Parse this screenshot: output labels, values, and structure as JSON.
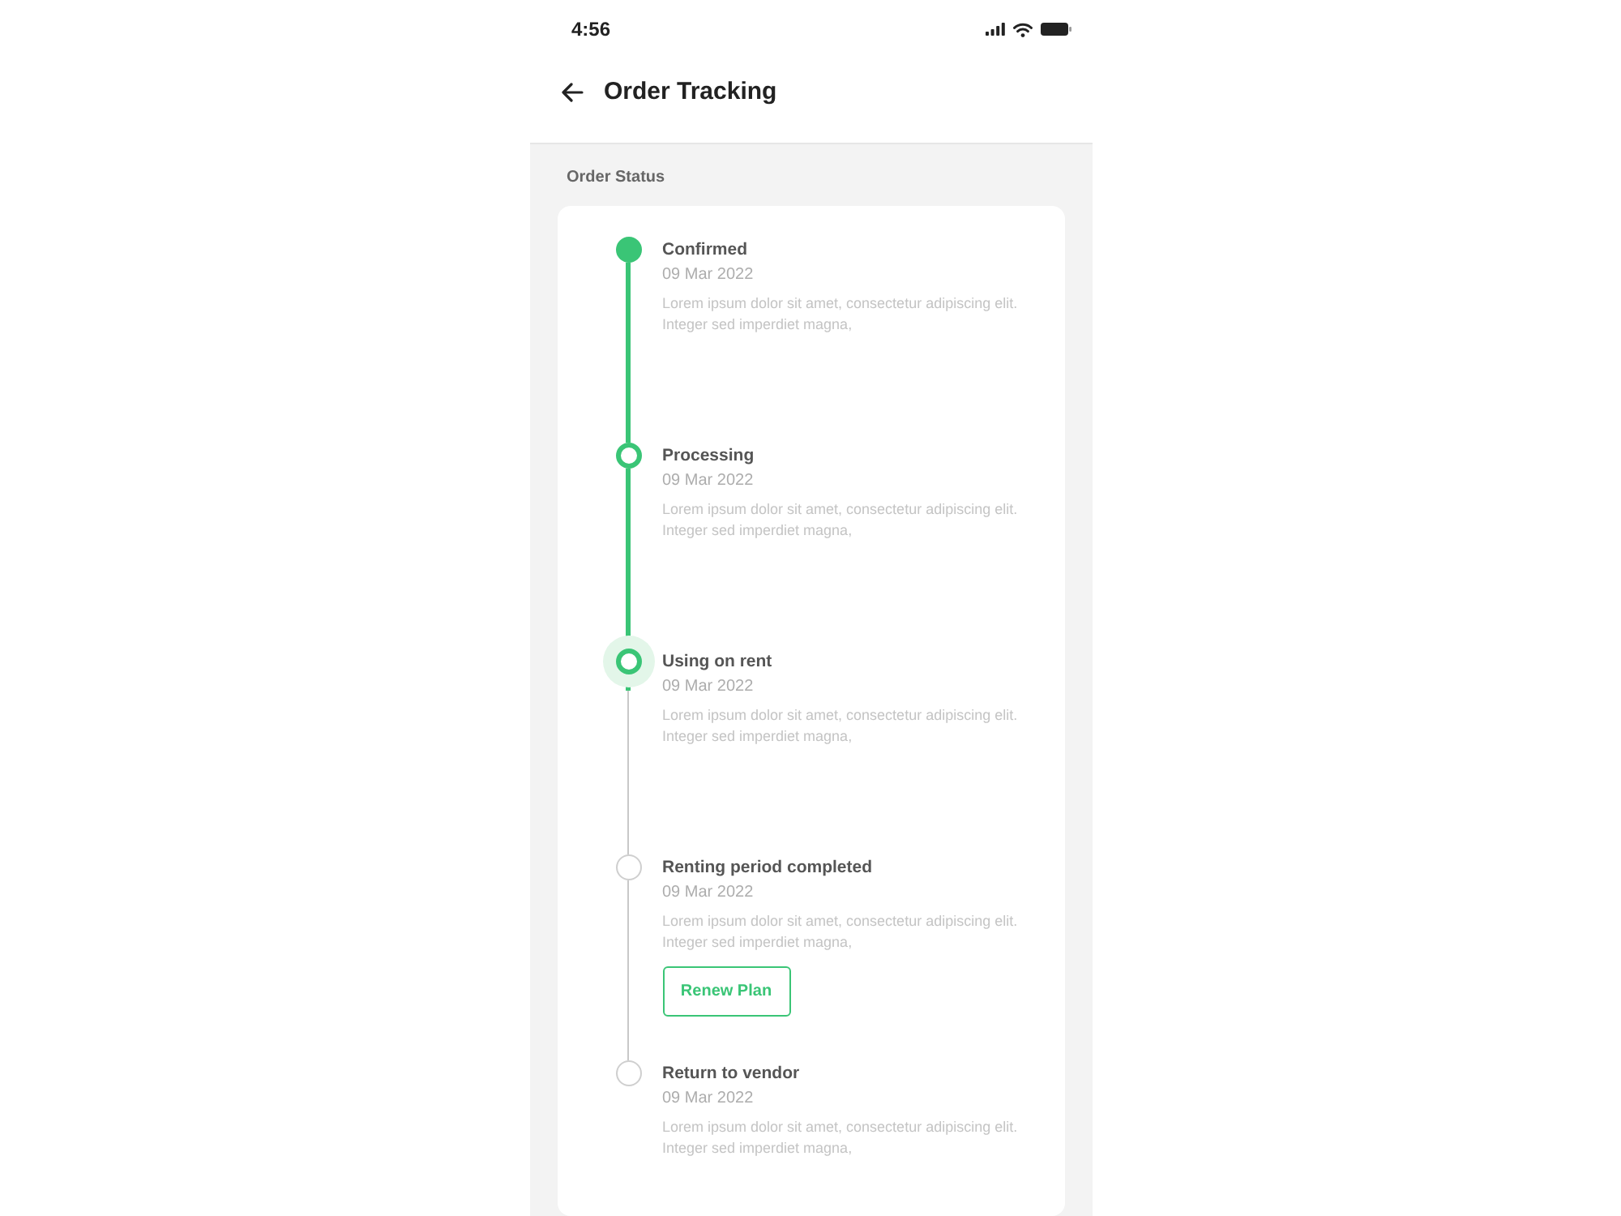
{
  "status_bar": {
    "time": "4:56"
  },
  "header": {
    "title": "Order Tracking"
  },
  "section": {
    "label": "Order Status"
  },
  "steps": [
    {
      "kind": "filled",
      "title": "Confirmed",
      "date": "09 Mar 2022",
      "description": "Lorem ipsum dolor sit amet, consectetur adipiscing elit. Integer sed imperdiet magna,"
    },
    {
      "kind": "ring",
      "title": "Processing",
      "date": "09 Mar 2022",
      "description": "Lorem ipsum dolor sit amet, consectetur adipiscing elit. Integer sed imperdiet magna,"
    },
    {
      "kind": "active",
      "title": "Using on rent",
      "date": "09 Mar 2022",
      "description": "Lorem ipsum dolor sit amet, consectetur adipiscing elit. Integer sed imperdiet magna,"
    },
    {
      "kind": "pending",
      "title": "Renting period completed",
      "date": "09 Mar 2022",
      "description": "Lorem ipsum dolor sit amet, consectetur adipiscing elit. Integer sed imperdiet magna,",
      "action": {
        "label": "Renew Plan"
      }
    },
    {
      "kind": "pending",
      "title": "Return to vendor",
      "date": "09 Mar 2022",
      "description": "Lorem ipsum dolor sit amet, consectetur adipiscing elit. Integer sed imperdiet magna,"
    }
  ]
}
